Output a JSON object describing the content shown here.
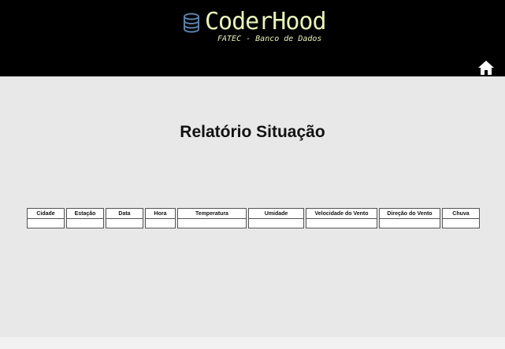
{
  "header": {
    "logo_title": "CoderHood",
    "logo_subtitle": "FATEC - Banco de Dados",
    "logo_icon": "database-icon",
    "home_icon": "home-icon",
    "brand_color": "#e8f3b9",
    "background": "#000000"
  },
  "main": {
    "title": "Relatório Situação",
    "background": "#e8e8e8"
  },
  "table": {
    "columns": [
      "Cidade",
      "Estação",
      "Data",
      "Hora",
      "Temperatura",
      "Umidade",
      "Velocidade do Vento",
      "Direção do Vento",
      "Chuva"
    ],
    "rows": [
      [
        "",
        "",
        "",
        "",
        "",
        "",
        "",
        "",
        ""
      ]
    ]
  }
}
